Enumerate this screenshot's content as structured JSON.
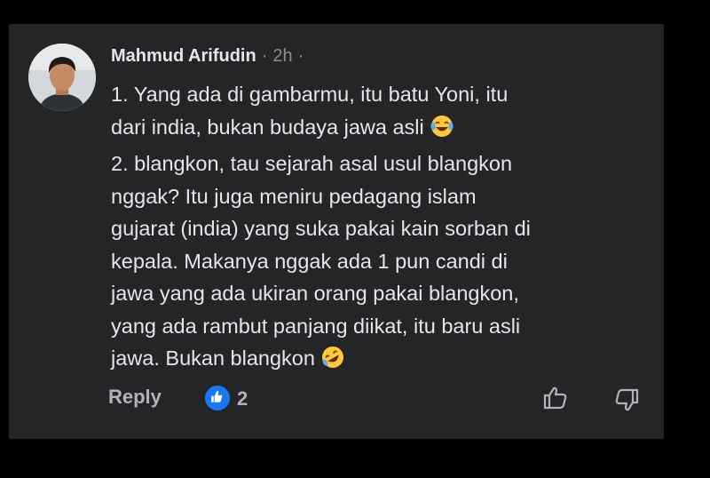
{
  "comment": {
    "author": "Mahmud Arifudin",
    "separator": "·",
    "time": "2h",
    "trailing": "·",
    "lines": [
      "1. Yang ada di gambarmu, itu batu Yoni, itu",
      "dari india, bukan budaya jawa asli",
      "2. blangkon, tau sejarah asal usul blangkon",
      "nggak? Itu juga meniru pedagang islam",
      "gujarat (india) yang suka pakai kain sorban di",
      "kepala. Makanya nggak ada 1 pun candi di",
      "jawa yang ada ukiran orang pakai blangkon,",
      "yang ada rambut panjang diikat, itu baru asli",
      "jawa. Bukan blangkon"
    ],
    "emojis": {
      "line_2": "tears-of-joy-emoji",
      "line_9": "rolling-on-floor-laughing-emoji"
    }
  },
  "actions": {
    "reply_label": "Reply",
    "reaction_icon": "like-reaction-icon",
    "reaction_count": "2",
    "upvote_icon": "thumbs-up-outline-icon",
    "downvote_icon": "thumbs-down-outline-icon"
  },
  "colors": {
    "page_background": "#000000",
    "card_background": "#242526",
    "primary_text": "#e4e6eb",
    "secondary_text": "#b0b3b8",
    "like_blue": "#1877f2"
  }
}
